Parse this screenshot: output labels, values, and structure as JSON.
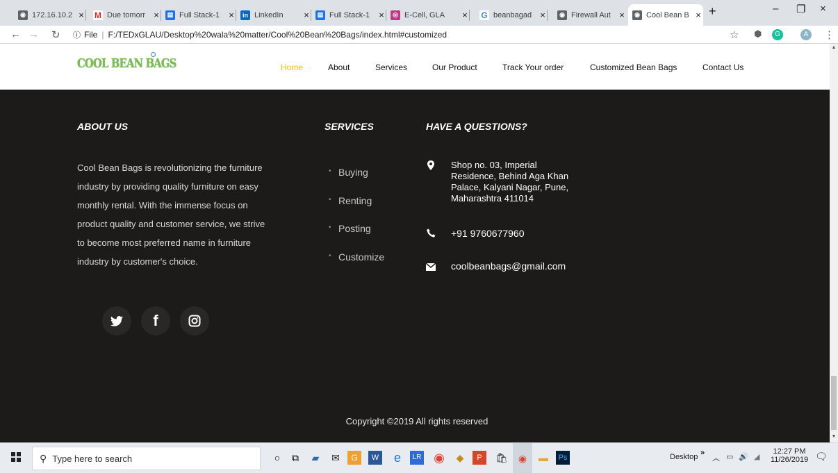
{
  "browser": {
    "tabs": [
      {
        "label": "172.16.10.2",
        "icon": "globe-icon",
        "color": "#5f6368"
      },
      {
        "label": "Due tomorr",
        "icon": "gmail-icon",
        "color": "#d93025"
      },
      {
        "label": "Full Stack-1",
        "icon": "doc-icon",
        "color": "#1a73e8"
      },
      {
        "label": "LinkedIn",
        "icon": "linkedin-icon",
        "color": "#0a66c2"
      },
      {
        "label": "Full Stack-1",
        "icon": "doc-icon",
        "color": "#1a73e8"
      },
      {
        "label": "E-Cell, GLA",
        "icon": "instagram-icon",
        "color": "#c13584"
      },
      {
        "label": "beanbagad",
        "icon": "google-icon",
        "color": "#4285f4"
      },
      {
        "label": "Firewall Aut",
        "icon": "globe-icon",
        "color": "#5f6368"
      },
      {
        "label": "Cool Bean B",
        "icon": "globe-icon",
        "color": "#5f6368"
      }
    ],
    "new_tab": "+",
    "close_glyph": "×",
    "url_info": "File",
    "url": "F:/TEDxGLAU/Desktop%20wala%20matter/Cool%20Bean%20Bags/index.html#customized",
    "profile_initial": "A"
  },
  "site": {
    "logo": "COOL BEAN BAGS",
    "nav": [
      "Home",
      "About",
      "Services",
      "Our Product",
      "Track Your order",
      "Customized Bean Bags",
      "Contact Us"
    ],
    "active_color": "#fdbe00",
    "footer": {
      "about_heading": "ABOUT US",
      "about_lines": [
        "Cool Bean Bags is revolutionizing the furniture",
        "industry by providing quality furniture on easy",
        "monthly rental. With the immense focus on",
        "product quality and customer service, we strive",
        "to become most preferred name in furniture",
        "industry by customer's choice."
      ],
      "services_heading": "SERVICES",
      "services": [
        "Buying",
        "Renting",
        "Posting",
        "Customize"
      ],
      "contact_heading": "HAVE A QUESTIONS?",
      "address_lines": [
        "Shop no. 03, Imperial",
        "Residence, Behind Aga Khan",
        "Palace, Kalyani Nagar, Pune,",
        "Maharashtra 411014"
      ],
      "phone": "+91 9760677960",
      "email": "coolbeanbags@gmail.com",
      "social": [
        {
          "icon": "twitter-icon",
          "glyph": "🐦"
        },
        {
          "icon": "facebook-icon",
          "glyph": "f"
        },
        {
          "icon": "instagram-icon",
          "glyph": "◎"
        }
      ],
      "copyright": "Copyright ©2019 All rights reserved"
    }
  },
  "taskbar": {
    "search_placeholder": "Type here to search",
    "desktop_label": "Desktop",
    "time": "12:27 PM",
    "date": "11/26/2019"
  }
}
